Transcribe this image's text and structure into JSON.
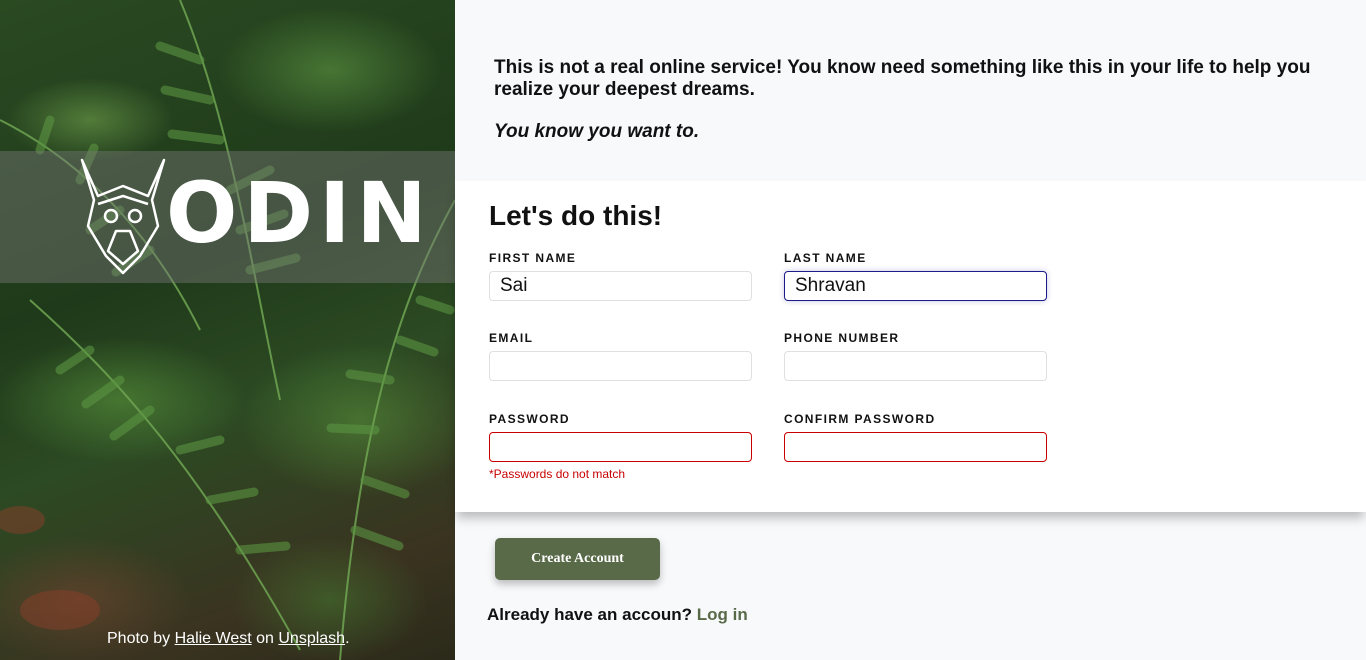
{
  "hero": {
    "brand": "ODIN",
    "credit_prefix": "Photo by ",
    "credit_author": "Halie West",
    "credit_middle": " on ",
    "credit_site": "Unsplash",
    "credit_suffix": "."
  },
  "intro": {
    "text": "This is not a real online service! You know need something like this in your life to help you realize your deepest dreams.",
    "tagline": "You know you want to."
  },
  "form": {
    "title": "Let's do this!",
    "first_name": {
      "label": "FIRST NAME",
      "value": "Sai"
    },
    "last_name": {
      "label": "LAST NAME",
      "value": "Shravan"
    },
    "email": {
      "label": "EMAIL",
      "value": ""
    },
    "phone": {
      "label": "PHONE NUMBER",
      "value": ""
    },
    "password": {
      "label": "PASSWORD",
      "value": ""
    },
    "confirm_password": {
      "label": "CONFIRM PASSWORD",
      "value": ""
    },
    "password_error": "*Passwords do not match"
  },
  "actions": {
    "create_label": "Create Account",
    "login_prompt": "Already have an accoun? ",
    "login_link": "Log in"
  },
  "colors": {
    "accent": "#596a48",
    "error": "#c80000",
    "focus": "#1b1b8a"
  }
}
